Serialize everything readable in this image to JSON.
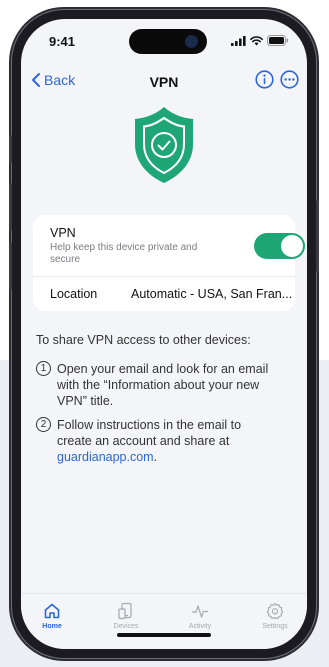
{
  "status_bar": {
    "time": "9:41"
  },
  "nav": {
    "back_label": "Back",
    "title": "VPN",
    "info_icon": "info-circle-icon",
    "more_icon": "ellipsis-circle-icon"
  },
  "shield": {
    "icon": "shield-check-icon",
    "color": "#1fa676"
  },
  "vpn_card": {
    "vpn_title": "VPN",
    "vpn_description": "Help keep this device private and secure",
    "toggle_on": true,
    "location_label": "Location",
    "location_value": "Automatic - USA, San Fran..."
  },
  "instructions": {
    "intro": "To share VPN access to other devices:",
    "steps": [
      {
        "number": "1",
        "text": "Open your email and look for an email with the “Information about your new VPN” title."
      },
      {
        "number": "2",
        "text": "Follow instructions in the email to create an account and share at ",
        "link": "guardianapp.com",
        "suffix": "."
      }
    ]
  },
  "tabs": [
    {
      "label": "Home",
      "icon": "home-icon",
      "active": true
    },
    {
      "label": "Devices",
      "icon": "devices-icon",
      "active": false
    },
    {
      "label": "Activity",
      "icon": "activity-icon",
      "active": false
    },
    {
      "label": "Settings",
      "icon": "gear-icon",
      "active": false
    }
  ],
  "colors": {
    "accent": "#2b66d9",
    "toggle": "#1fa676",
    "shield": "#1fa676"
  }
}
